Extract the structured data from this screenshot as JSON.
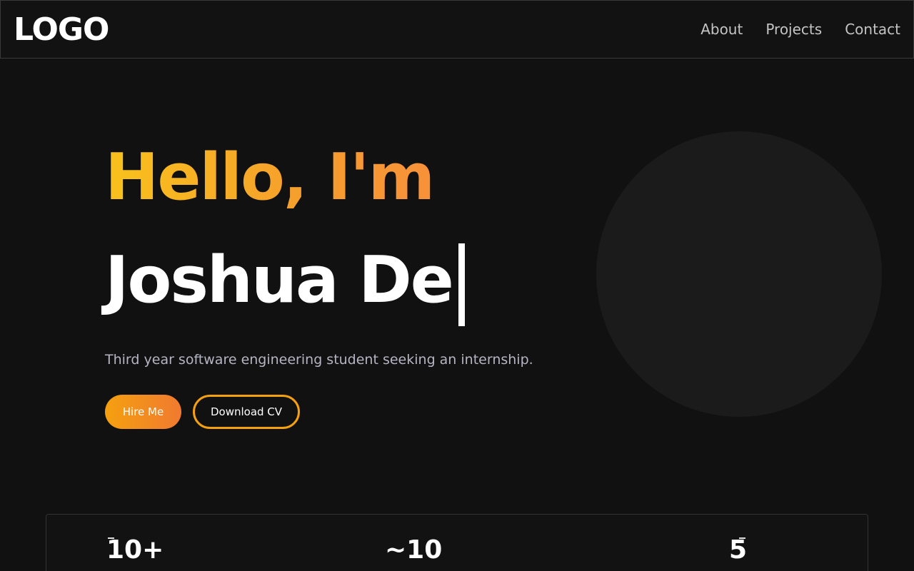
{
  "nav": {
    "logo": "LOGO",
    "links": [
      "About",
      "Projects",
      "Contact"
    ]
  },
  "hero": {
    "greeting": "Hello, I'm",
    "name": "Joshua De",
    "tagline": "Third year software engineering student seeking an internship.",
    "primary_button": "Hire Me",
    "secondary_button": "Download CV"
  },
  "stats": [
    {
      "value": "10+"
    },
    {
      "value": "~10"
    },
    {
      "value": "5"
    }
  ],
  "colors": {
    "background": "#111111",
    "accent_start": "#f9c21c",
    "accent_end": "#f07a30",
    "text_muted": "#b5b5c3"
  }
}
